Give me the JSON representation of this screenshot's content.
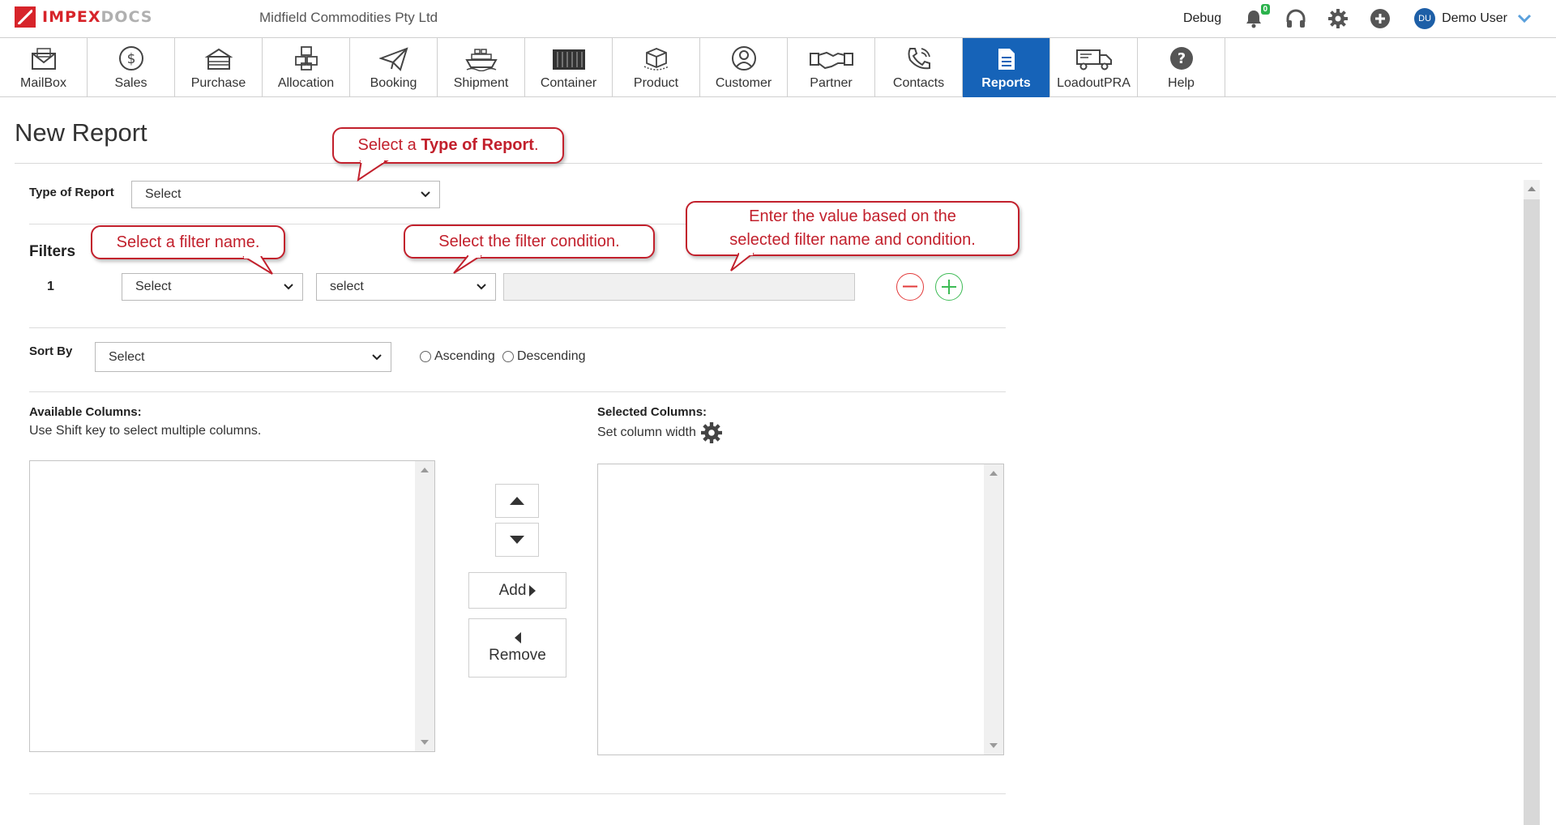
{
  "brand": {
    "name_main": "IMPEX",
    "name_sub": "DOCS",
    "accent": "#d7242a"
  },
  "header": {
    "company": "Midfield Commodities Pty Ltd",
    "debug_label": "Debug",
    "notification_count": "0",
    "user_initials": "DU",
    "user_name": "Demo User"
  },
  "nav": {
    "active_color": "#1663b8",
    "items": [
      {
        "label": "MailBox",
        "icon": "mailbox-icon"
      },
      {
        "label": "Sales",
        "icon": "dollar-icon"
      },
      {
        "label": "Purchase",
        "icon": "purchase-icon"
      },
      {
        "label": "Allocation",
        "icon": "boxes-icon"
      },
      {
        "label": "Booking",
        "icon": "paper-plane-icon"
      },
      {
        "label": "Shipment",
        "icon": "ship-icon"
      },
      {
        "label": "Container",
        "icon": "container-icon"
      },
      {
        "label": "Product",
        "icon": "product-box-icon"
      },
      {
        "label": "Customer",
        "icon": "customer-icon"
      },
      {
        "label": "Partner",
        "icon": "handshake-icon"
      },
      {
        "label": "Contacts",
        "icon": "phone-icon"
      },
      {
        "label": "Reports",
        "icon": "report-icon",
        "active": true
      },
      {
        "label": "LoadoutPRA",
        "icon": "truck-icon"
      },
      {
        "label": "Help",
        "icon": "help-icon"
      }
    ]
  },
  "page": {
    "title": "New Report"
  },
  "form": {
    "type_of_report_label": "Type of Report",
    "type_of_report_value": "Select",
    "filters_label": "Filters",
    "filter_row_number": "1",
    "filter_name_value": "Select",
    "filter_condition_value": "select",
    "filter_value": "",
    "sort_by_label": "Sort By",
    "sort_by_value": "Select",
    "ascending_label": "Ascending",
    "descending_label": "Descending"
  },
  "columns": {
    "available_title": "Available Columns:",
    "available_hint": "Use Shift key to select multiple columns.",
    "selected_title": "Selected Columns:",
    "selected_hint": "Set column width",
    "add_label": "Add",
    "remove_label": "Remove"
  },
  "callouts": {
    "type_prefix": "Select a ",
    "type_bold": "Type of Report",
    "type_suffix": ".",
    "filter_name": "Select a filter name.",
    "filter_condition": "Select the filter condition.",
    "value_line1": "Enter the value based on the",
    "value_line2": "selected filter name and condition.",
    "color": "#c2202c"
  }
}
